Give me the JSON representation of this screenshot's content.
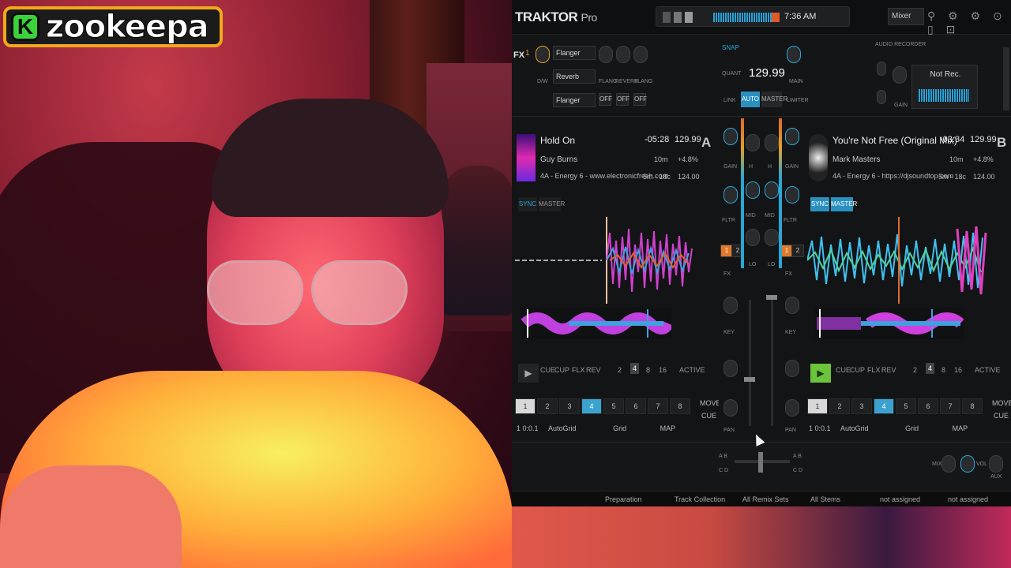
{
  "streamer": {
    "badge_letter": "K",
    "name": "zookeepa"
  },
  "app": {
    "logo": "TRAKTOR",
    "logo_suffix": "Pro",
    "time": "7:36 AM",
    "mixer_mode": "Mixer"
  },
  "fx": {
    "label": "FX",
    "unit_num": "1",
    "dw": "D/W",
    "effects": [
      "Flanger",
      "Reverb",
      "Flanger"
    ],
    "knob_labels": [
      "FLANG",
      "REVERB",
      "FLANG"
    ],
    "off_labels": [
      "OFF",
      "OFF",
      "OFF"
    ]
  },
  "master": {
    "snap": "SNAP",
    "quant": "QUANT",
    "bpm": "129.99",
    "link": "LINK",
    "auto": "AUTO",
    "master": "MASTER",
    "main": "MAIN",
    "limiter": "LIMITER"
  },
  "recorder": {
    "title": "AUDIO RECORDER",
    "status": "Not Rec.",
    "gain": "GAIN"
  },
  "deck_a": {
    "letter": "A",
    "title": "Hold On",
    "artist": "Guy Burns",
    "info": "4A - Energy 6 - www.electronicfresh.com",
    "time_remaining": "-05:28",
    "bpm": "129.99",
    "length": "10m",
    "pitch": "+4.8%",
    "offset": "5m - 18c",
    "orig_bpm": "124.00",
    "sync": "SYNC",
    "master": "MASTER",
    "cue": "CUE",
    "cup": "CUP",
    "flx": "FLX",
    "rev": "REV",
    "loops": [
      "2",
      "4",
      "8",
      "16"
    ],
    "active": "ACTIVE",
    "cues": [
      "1",
      "2",
      "3",
      "4",
      "5",
      "6",
      "7",
      "8"
    ],
    "grid_pos": "1 0:0.1",
    "autogrid": "AutoGrid",
    "grid": "Grid",
    "map": "MAP",
    "move": "MOVE",
    "cue_label": "CUE",
    "grid_label": "GRID"
  },
  "deck_b": {
    "letter": "B",
    "title": "You're Not Free (Original Mix)",
    "artist": "Mark Masters",
    "info": "4A - Energy 6 - https://djsoundtop.com",
    "time_remaining": "-03:34",
    "bpm": "129.99",
    "length": "10m",
    "pitch": "+4.8%",
    "offset": "5m - 18c",
    "orig_bpm": "124.00",
    "sync": "SYNC",
    "master": "MASTER",
    "cue": "CUE",
    "cup": "CUP",
    "flx": "FLX",
    "rev": "REV",
    "loops": [
      "2",
      "4",
      "8",
      "16"
    ],
    "active": "ACTIVE",
    "cues": [
      "1",
      "2",
      "3",
      "4",
      "5",
      "6",
      "7",
      "8"
    ],
    "grid_pos": "1 0:0.1",
    "autogrid": "AutoGrid",
    "grid": "Grid",
    "map": "MAP",
    "move": "MOVE",
    "cue_label": "CUE",
    "grid_label": "GRID"
  },
  "mixer": {
    "labels": [
      "GAIN",
      "H",
      "MID",
      "LO",
      "FLTR",
      "FX",
      "KEY",
      "PAN"
    ],
    "fx_assign": [
      "1",
      "2"
    ],
    "ab": "A B",
    "cd": "C D"
  },
  "footer": {
    "mix": "MIX",
    "vol": "VOL",
    "aux": "AUX"
  },
  "browser": [
    "Preparation",
    "Track Collection",
    "All Remix Sets",
    "All Stems",
    "not assigned",
    "not assigned"
  ],
  "colors": {
    "accent": "#2a90c0",
    "orange": "#e09a2a",
    "green": "#6bc43a"
  }
}
